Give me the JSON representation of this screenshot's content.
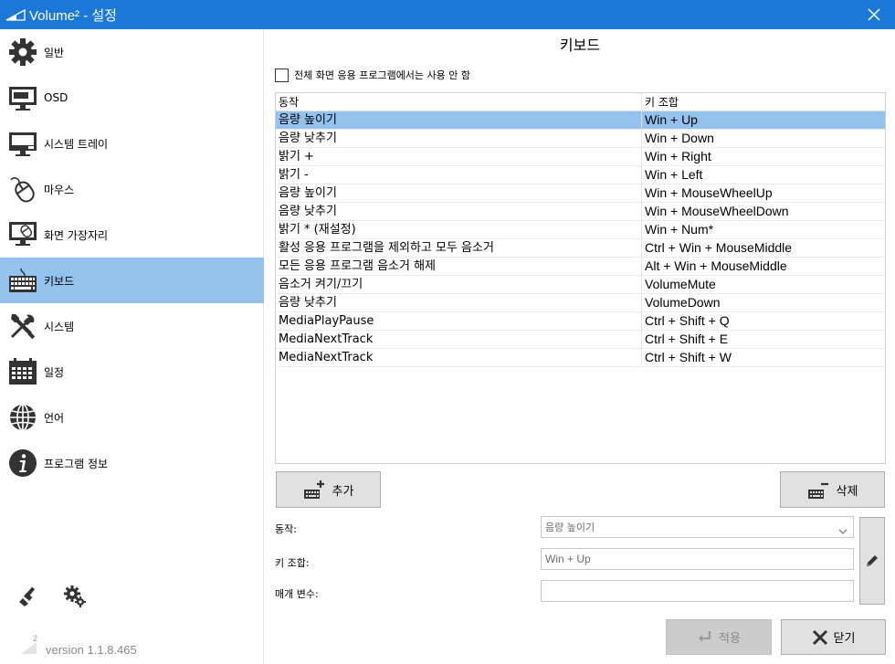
{
  "window": {
    "title": "Volume² - 설정"
  },
  "sidebar": {
    "items": [
      {
        "label": "일반",
        "icon": "gear-icon"
      },
      {
        "label": "OSD",
        "icon": "monitor-icon"
      },
      {
        "label": "시스템 트레이",
        "icon": "taskbar-monitor-icon"
      },
      {
        "label": "마우스",
        "icon": "mouse-icon"
      },
      {
        "label": "화면 가장자리",
        "icon": "screen-mouse-icon"
      },
      {
        "label": "키보드",
        "icon": "keyboard-icon"
      },
      {
        "label": "시스템",
        "icon": "tools-icon"
      },
      {
        "label": "일정",
        "icon": "calendar-icon"
      },
      {
        "label": "언어",
        "icon": "globe-icon"
      },
      {
        "label": "프로그램 정보",
        "icon": "info-icon"
      }
    ],
    "active_index": 5,
    "version": "version 1.1.8.465"
  },
  "main": {
    "title": "키보드",
    "fullscreen_checkbox": {
      "label": "전체 화면 응용 프로그램에서는 사용 안 함",
      "checked": false
    },
    "table": {
      "headers": [
        "동작",
        "키 조합"
      ],
      "rows": [
        [
          "음량 높이기",
          "Win + Up"
        ],
        [
          "음량 낮추기",
          "Win + Down"
        ],
        [
          "밝기 +",
          "Win + Right"
        ],
        [
          "밝기 -",
          "Win + Left"
        ],
        [
          "음량 높이기",
          "Win + MouseWheelUp"
        ],
        [
          "음량 낮추기",
          "Win + MouseWheelDown"
        ],
        [
          "밝기 * (재설정)",
          "Win + Num*"
        ],
        [
          "활성 응용 프로그램을 제외하고 모두 음소거",
          "Ctrl + Win + MouseMiddle"
        ],
        [
          "모든 응용 프로그램 음소거 해제",
          "Alt + Win + MouseMiddle"
        ],
        [
          "음소거 켜기/끄기",
          "VolumeMute"
        ],
        [
          "음량 낮추기",
          "VolumeDown"
        ],
        [
          "MediaPlayPause",
          "Ctrl + Shift + Q"
        ],
        [
          "MediaNextTrack",
          "Ctrl + Shift + E"
        ],
        [
          "MediaNextTrack",
          "Ctrl + Shift + W"
        ]
      ],
      "selected_index": 0
    },
    "add_button": "추가",
    "delete_button": "삭제",
    "form": {
      "action_label": "동작:",
      "action_value": "음량 높이기",
      "key_label": "키 조합:",
      "key_value": "Win + Up",
      "param_label": "매개 변수:",
      "param_value": ""
    },
    "apply_button": "적용",
    "close_button": "닫기"
  },
  "colors": {
    "titlebar": "#1a78d6",
    "selection": "#93c3ed"
  }
}
